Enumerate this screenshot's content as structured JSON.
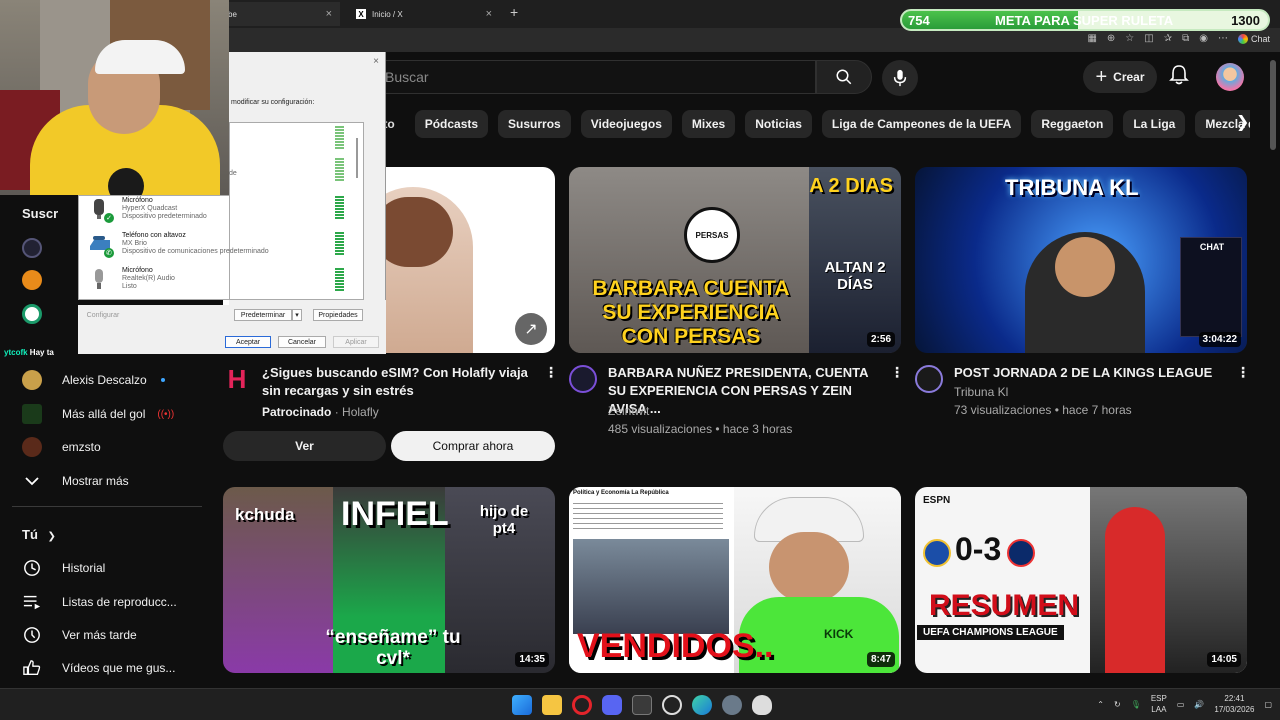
{
  "browser": {
    "tabs": [
      {
        "label": "be"
      },
      {
        "label": "Inicio / X"
      }
    ],
    "new_tab": "+",
    "chat_label": "Chat"
  },
  "goal_bar": {
    "start": "754",
    "label": "META PARA SUPER RULETA",
    "end": "1300",
    "progress": 0.48
  },
  "header": {
    "search_placeholder": "Buscar",
    "create_label": "Crear"
  },
  "chips": [
    "ecto",
    "Pódcasts",
    "Susurros",
    "Videojuegos",
    "Mixes",
    "Noticias",
    "Liga de Campeones de la UEFA",
    "Reggaeton",
    "La Liga",
    "Mezcla de a"
  ],
  "sidebar": {
    "subs_heading": "Suscr",
    "channels": [
      {
        "name": "Alexis Descalzo",
        "color": "#c9a04a",
        "badge": "dot"
      },
      {
        "name": "Más allá del gol",
        "color": "#1a3a1a",
        "badge": "live"
      },
      {
        "name": "emzsto",
        "color": "#5a2a1a",
        "badge": ""
      }
    ],
    "show_more": "Mostrar más",
    "you_heading": "Tú",
    "you_items": [
      {
        "label": "Historial",
        "icon": "history-icon"
      },
      {
        "label": "Listas de reproducc...",
        "icon": "playlist-icon"
      },
      {
        "label": "Ver más tarde",
        "icon": "clock-icon"
      },
      {
        "label": "Vídeos que me gus...",
        "icon": "thumbs-up-icon"
      }
    ]
  },
  "stream_overlay": {
    "chat_user": "ytcofk",
    "chat_text": "Hay ta"
  },
  "sound_dialog": {
    "instruction": "modificar su configuración:",
    "devices": [
      {
        "name": "Micrófono",
        "sub1": "HyperX Quadcast",
        "sub2": "Dispositivo predeterminado",
        "check": true
      },
      {
        "name": "Teléfono con altavoz",
        "sub1": "MX Brio",
        "sub2": "Dispositivo de comunicaciones predeterminado",
        "check": true
      },
      {
        "name": "Micrófono",
        "sub1": "Realtek(R) Audio",
        "sub2": "Listo",
        "check": false
      }
    ],
    "partial_sub": "de",
    "configure": "Configurar",
    "set_default": "Predeterminar",
    "properties": "Propiedades",
    "accept": "Aceptar",
    "cancel": "Cancelar",
    "apply": "Aplicar"
  },
  "videos": [
    {
      "title": "¿Sigues buscando eSIM? Con Holafly viaja sin recargas y sin estrés",
      "sponsored": "Patrocinado",
      "channel": "Holafly",
      "btn_ver": "Ver",
      "btn_buy": "Comprar ahora"
    },
    {
      "title": "BARBARA NUÑEZ PRESIDENTA, CUENTA SU EXPERIENCIA CON PERSAS Y ZEIN AVISA ...",
      "channel": "Zeintwit",
      "meta": "485 visualizaciones • hace 3 horas",
      "duration": "2:56",
      "thumb_top": "A 2 DIAS",
      "thumb_main": "BARBARA CUENTA SU EXPERIENCIA CON PERSAS",
      "thumb_side": "ALTAN 2 DÍAS",
      "thumb_brand": "PERSAS"
    },
    {
      "title": "POST JORNADA 2 DE LA KINGS LEAGUE",
      "channel": "Tribuna Kl",
      "meta": "73 visualizaciones • hace 7 horas",
      "duration": "3:04:22",
      "thumb_title": "TRIBUNA KL",
      "thumb_chat": "CHAT"
    },
    {
      "duration": "14:35",
      "thumb_left": "kchuda",
      "thumb_center": "INFIEL",
      "thumb_right": "hijo de pt4",
      "thumb_bottom": "“enseñame” tu cvl*"
    },
    {
      "duration": "8:47",
      "thumb_source": "Política y Economía La República",
      "thumb_main": "VENDIDOS..",
      "thumb_cap": "KICK"
    },
    {
      "duration": "14:05",
      "thumb_score": "0-3",
      "thumb_main": "RESUMEN",
      "thumb_sub": "UEFA CHAMPIONS LEAGUE",
      "thumb_brand": "ESPN"
    }
  ],
  "taskbar": {
    "lang1": "ESP",
    "lang2": "LAA",
    "time": "22:41",
    "date": "17/03/2026"
  }
}
